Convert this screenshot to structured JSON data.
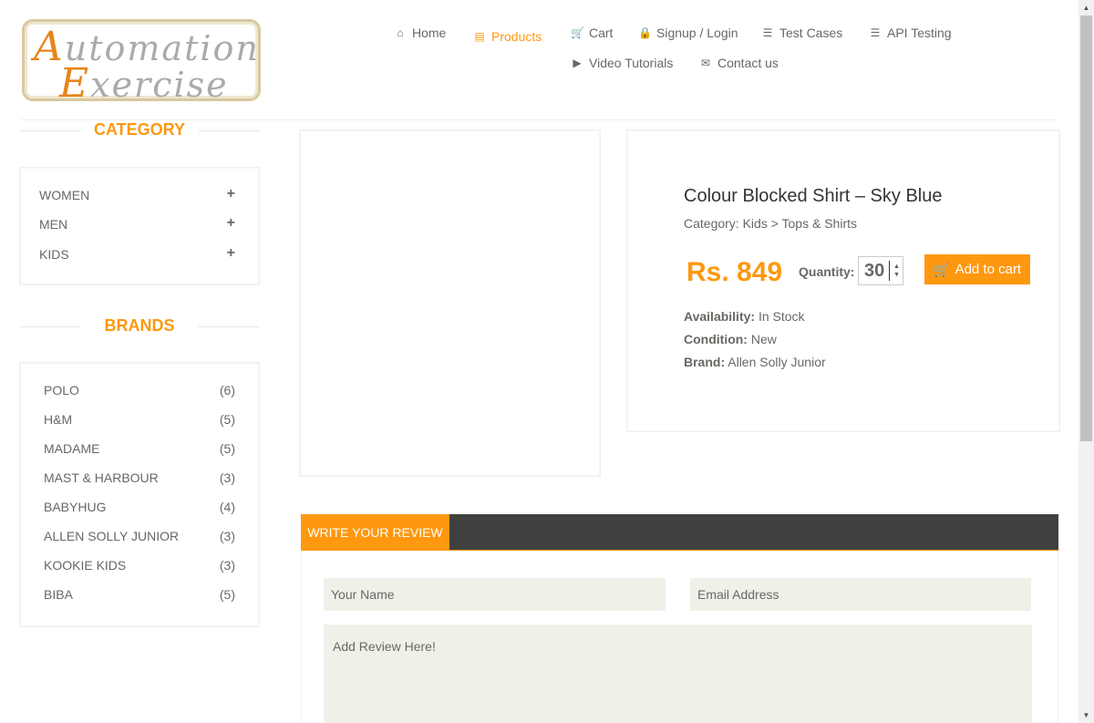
{
  "logo": {
    "text": "Automation Exercise",
    "line1_cap": "A",
    "line1_rest": "utomation",
    "line2_cap": "E",
    "line2_rest": "xercise"
  },
  "nav": [
    {
      "label": "Home",
      "icon": "home-icon"
    },
    {
      "label": "Products",
      "icon": "briefcase-icon",
      "active": true
    },
    {
      "label": "Cart",
      "icon": "cart-icon"
    },
    {
      "label": "Signup / Login",
      "icon": "lock-icon"
    },
    {
      "label": "Test Cases",
      "icon": "list-icon"
    },
    {
      "label": "API Testing",
      "icon": "list-icon"
    },
    {
      "label": "Video Tutorials",
      "icon": "youtube-icon"
    },
    {
      "label": "Contact us",
      "icon": "envelope-icon"
    }
  ],
  "sidebar": {
    "category_title": "CATEGORY",
    "categories": [
      "WOMEN",
      "MEN",
      "KIDS"
    ],
    "brands_title": "BRANDS",
    "brands": [
      {
        "name": "POLO",
        "count": "(6)"
      },
      {
        "name": "H&M",
        "count": "(5)"
      },
      {
        "name": "MADAME",
        "count": "(5)"
      },
      {
        "name": "MAST & HARBOUR",
        "count": "(3)"
      },
      {
        "name": "BABYHUG",
        "count": "(4)"
      },
      {
        "name": "ALLEN SOLLY JUNIOR",
        "count": "(3)"
      },
      {
        "name": "KOOKIE KIDS",
        "count": "(3)"
      },
      {
        "name": "BIBA",
        "count": "(5)"
      }
    ]
  },
  "product": {
    "title": "Colour Blocked Shirt – Sky Blue",
    "category": "Category: Kids > Tops & Shirts",
    "price": "Rs. 849",
    "quantity_label": "Quantity:",
    "quantity": "30",
    "add_to_cart": "Add to cart",
    "availability_label": "Availability:",
    "availability": "In Stock",
    "condition_label": "Condition:",
    "condition": "New",
    "brand_label": "Brand:",
    "brand": "Allen Solly Junior"
  },
  "review": {
    "tab_label": "WRITE YOUR REVIEW",
    "name_placeholder": "Your Name",
    "email_placeholder": "Email Address",
    "review_placeholder": "Add Review Here!"
  },
  "colors": {
    "accent": "#fe980f",
    "text": "#696763",
    "tab_bar": "#40403e"
  }
}
